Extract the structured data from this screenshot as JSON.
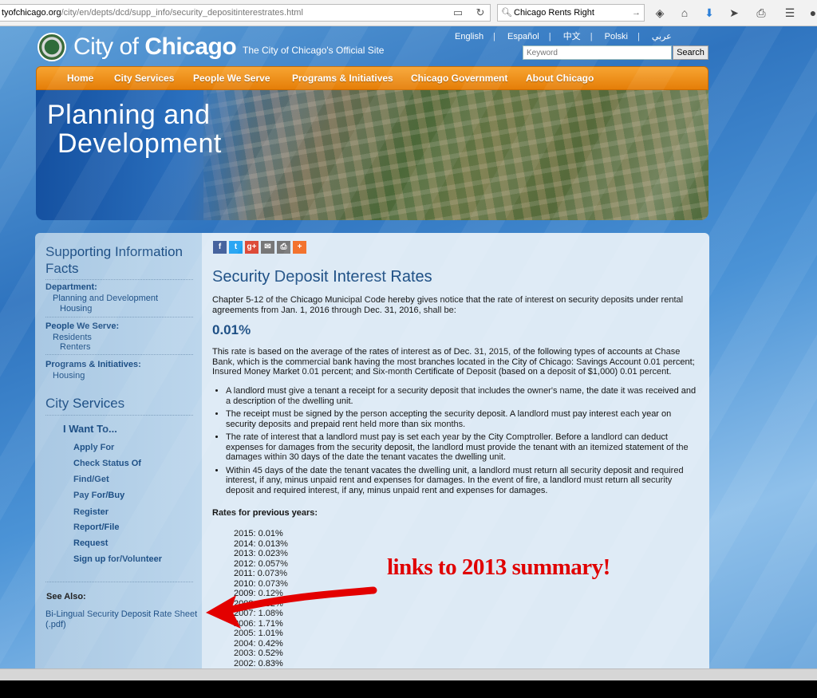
{
  "browser": {
    "url_domain": "tyofchicago.org",
    "url_path": "/city/en/depts/dcd/supp_info/security_depositinterestrates.html",
    "search_value": "Chicago Rents Right"
  },
  "header": {
    "logo_city": "City of ",
    "logo_chicago": "Chicago",
    "tagline": "The City of Chicago's Official Site",
    "languages": [
      "English",
      "Español",
      "中文",
      "Polski",
      "عربي"
    ],
    "search_placeholder": "Keyword",
    "search_button": "Search"
  },
  "nav": [
    "Home",
    "City Services",
    "People We Serve",
    "Programs & Initiatives",
    "Chicago Government",
    "About Chicago"
  ],
  "banner": {
    "line1": "Planning and",
    "line2": "Development"
  },
  "sidebar": {
    "heading": "Supporting Information Facts",
    "department_label": "Department:",
    "department_link_line1": "Planning and Development",
    "department_link_line2": "Housing",
    "people_label": "People We Serve:",
    "people_link1": "Residents",
    "people_link2": "Renters",
    "programs_label": "Programs & Initiatives:",
    "programs_link": "Housing",
    "city_services": "City Services",
    "i_want_to": "I Want To...",
    "actions": [
      "Apply For",
      "Check Status Of",
      "Find/Get",
      "Pay For/Buy",
      "Register",
      "Report/File",
      "Request",
      "Sign up for/Volunteer"
    ],
    "see_also": "See Also:",
    "rate_sheet": "Bi-Lingual Security Deposit Rate Sheet (.pdf)"
  },
  "content": {
    "title": "Security Deposit Interest Rates",
    "intro": "Chapter 5-12 of the Chicago Municipal Code hereby gives notice that the rate of interest on security deposits under rental agreements from Jan. 1, 2016 through Dec. 31, 2016, shall be:",
    "rate": "0.01%",
    "basis": "This rate is based on the average of the rates of interest as of Dec. 31, 2015, of the following types of accounts at Chase Bank, which is the commercial bank having the most branches located in the City of Chicago: Savings Account 0.01 percent; Insured Money Market 0.01 percent; and Six-month Certificate of Deposit (based on a deposit of $1,000) 0.01 percent.",
    "bullets": [
      "A landlord must give a tenant a receipt for a security deposit that includes the owner's name, the date it was received and a description of the dwelling unit.",
      "The receipt must be signed by the person accepting the security deposit. A landlord must pay interest each year on security deposits and prepaid rent held more than six months.",
      "The rate of interest that a landlord must pay is set each year by the City Comptroller. Before a landlord can deduct expenses for damages from the security deposit, the landlord must provide the tenant with an itemized statement of the damages within 30 days of the date the tenant vacates the dwelling unit.",
      "Within 45 days of the date the tenant vacates the dwelling unit, a landlord must return all security deposit and required interest, if any, minus unpaid rent and expenses for damages. In the event of fire, a landlord must return all security deposit and required interest, if any, minus unpaid rent and expenses for damages."
    ],
    "previous_label": "Rates for previous years:",
    "previous_rates": [
      "2015: 0.01%",
      "2014: 0.013%",
      "2013: 0.023%",
      "2012: 0.057%",
      "2011: 0.073%",
      "2010: 0.073%",
      "2009: 0.12%",
      "2008: 1.32%",
      "2007: 1.08%",
      "2006: 1.71%",
      "2005: 1.01%",
      "2004: 0.42%",
      "2003: 0.52%",
      "2002: 0.83%"
    ]
  },
  "annotation": "links to 2013 summary!",
  "colors": {
    "nav_orange": "#f08c13",
    "link_blue": "#1d4f85",
    "annotation_red": "#e00000"
  }
}
